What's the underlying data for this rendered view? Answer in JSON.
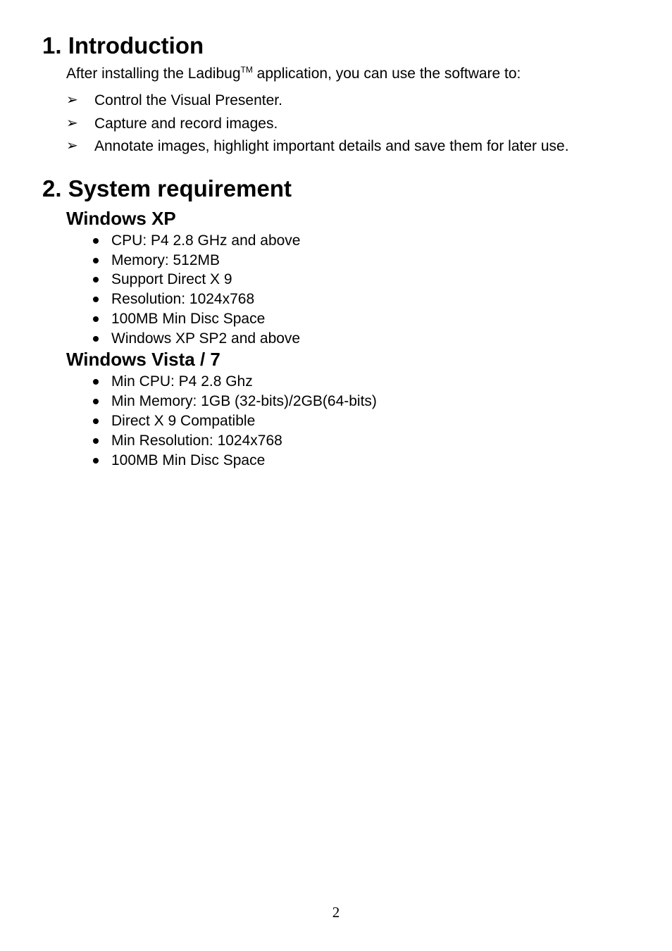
{
  "section1": {
    "heading": "1. Introduction",
    "intro_prefix": "After installing the Ladibug",
    "intro_tm": "TM",
    "intro_suffix": " application, you can use the software to:",
    "items": [
      "Control the Visual Presenter.",
      "Capture and record images.",
      "Annotate images, highlight important details and save them for later use."
    ]
  },
  "section2": {
    "heading": "2. System requirement",
    "group_a": {
      "title": "Windows XP",
      "items": [
        "CPU: P4 2.8 GHz and above",
        "Memory: 512MB",
        "Support Direct X 9",
        "Resolution: 1024x768",
        "100MB Min Disc Space",
        "Windows XP SP2 and above"
      ]
    },
    "group_b": {
      "title": "Windows Vista / 7",
      "items": [
        "Min CPU: P4 2.8 Ghz",
        "Min Memory: 1GB (32-bits)/2GB(64-bits)",
        "Direct X 9 Compatible",
        "Min Resolution: 1024x768",
        "100MB Min Disc Space"
      ]
    }
  },
  "page_number": "2"
}
